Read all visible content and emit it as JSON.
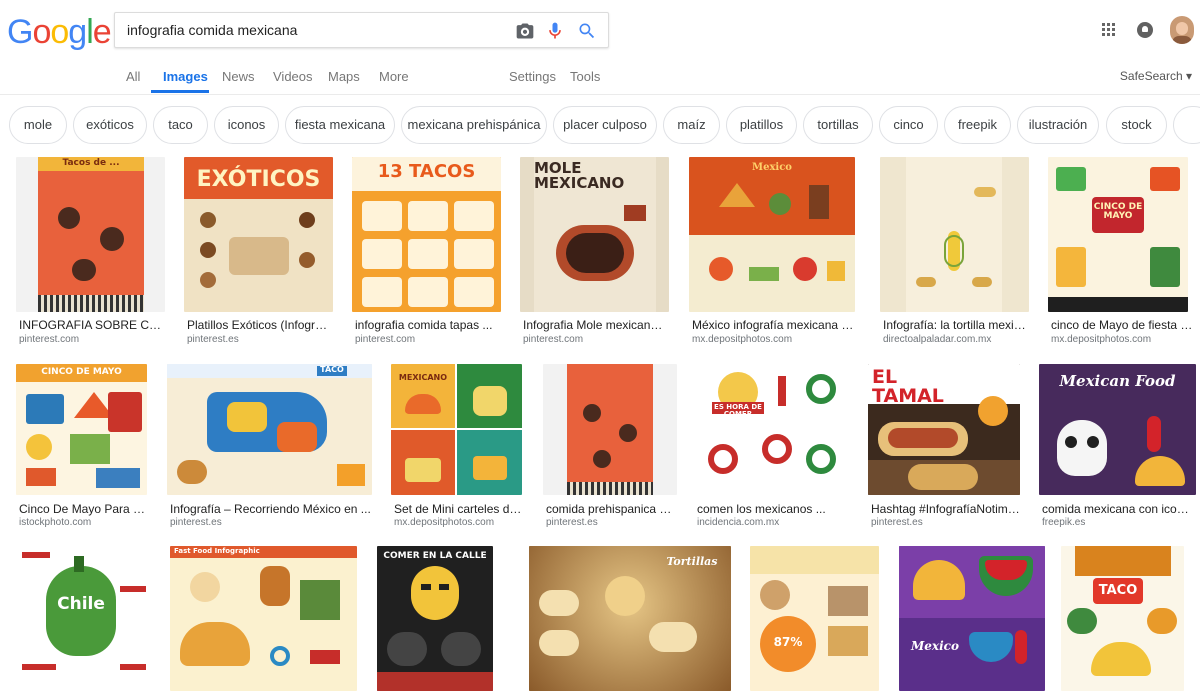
{
  "search": {
    "query": "infografia comida mexicana",
    "logo": "Google"
  },
  "nav": {
    "tabs": [
      "All",
      "Images",
      "News",
      "Videos",
      "Maps",
      "More"
    ],
    "active": "Images",
    "settings": "Settings",
    "tools": "Tools",
    "safesearch": "SafeSearch ▾"
  },
  "chips": [
    "mole",
    "exóticos",
    "taco",
    "iconos",
    "fiesta mexicana",
    "mexicana prehispánica",
    "placer culposo",
    "maíz",
    "platillos",
    "tortillas",
    "cinco",
    "freepik",
    "ilustración",
    "stock"
  ],
  "results": [
    {
      "title": "INFOGRAFIA SOBRE COMIDA M...",
      "source": "pinterest.com",
      "thumb_text": "Tacos de ..."
    },
    {
      "title": "Platillos Exóticos (Infografía ...",
      "source": "pinterest.es",
      "thumb_text": "EXÓTICOS"
    },
    {
      "title": "infografia comida tapas ...",
      "source": "pinterest.com",
      "thumb_text": "13 TACOS"
    },
    {
      "title": "Infografia Mole mexicano, tradi...",
      "source": "pinterest.com",
      "thumb_text": "MOLE MEXICANO"
    },
    {
      "title": "México infografía mexicana cultura y...",
      "source": "mx.depositphotos.com",
      "thumb_text": "Mexico"
    },
    {
      "title": "Infografía: la tortilla mexicana ...",
      "source": "directoalpaladar.com.mx",
      "thumb_text": ""
    },
    {
      "title": "cinco de Mayo de fiesta mexica...",
      "source": "mx.depositphotos.com",
      "thumb_text": "CINCO DE MAYO"
    },
    {
      "title": "Cinco De Mayo Para Fiesta ...",
      "source": "istockphoto.com",
      "thumb_text": "CINCO DE MAYO"
    },
    {
      "title": "Infografía – Recorriendo México en ...",
      "source": "pinterest.es",
      "thumb_text": "TACO"
    },
    {
      "title": "Set de Mini carteles de com...",
      "source": "mx.depositphotos.com",
      "thumb_text": "MEXICANO"
    },
    {
      "title": "comida prehispanica mexic...",
      "source": "pinterest.es",
      "thumb_text": ""
    },
    {
      "title": "comen los mexicanos ...",
      "source": "incidencia.com.mx",
      "thumb_text": "ES HORA DE COMER"
    },
    {
      "title": "Hashtag #InfografíaNotimex sur...",
      "source": "pinterest.es",
      "thumb_text": "EL TAMAL"
    },
    {
      "title": "comida mexicana con iconos rela...",
      "source": "freepik.es",
      "thumb_text": "Mexican Food"
    },
    {
      "title": "",
      "source": "",
      "thumb_text": "Chile"
    },
    {
      "title": "",
      "source": "",
      "thumb_text": "Fast Food Infographic"
    },
    {
      "title": "",
      "source": "",
      "thumb_text": "COMER EN LA CALLE"
    },
    {
      "title": "",
      "source": "",
      "thumb_text": "Tortillas"
    },
    {
      "title": "",
      "source": "",
      "thumb_text": "87%"
    },
    {
      "title": "",
      "source": "",
      "thumb_text": "Mexico"
    },
    {
      "title": "",
      "source": "",
      "thumb_text": "TACO"
    }
  ],
  "colors": {
    "google_blue": "#4285f4",
    "google_red": "#ea4335",
    "google_yellow": "#fbbc05",
    "google_green": "#34a853",
    "active_tab": "#1a73e8"
  }
}
